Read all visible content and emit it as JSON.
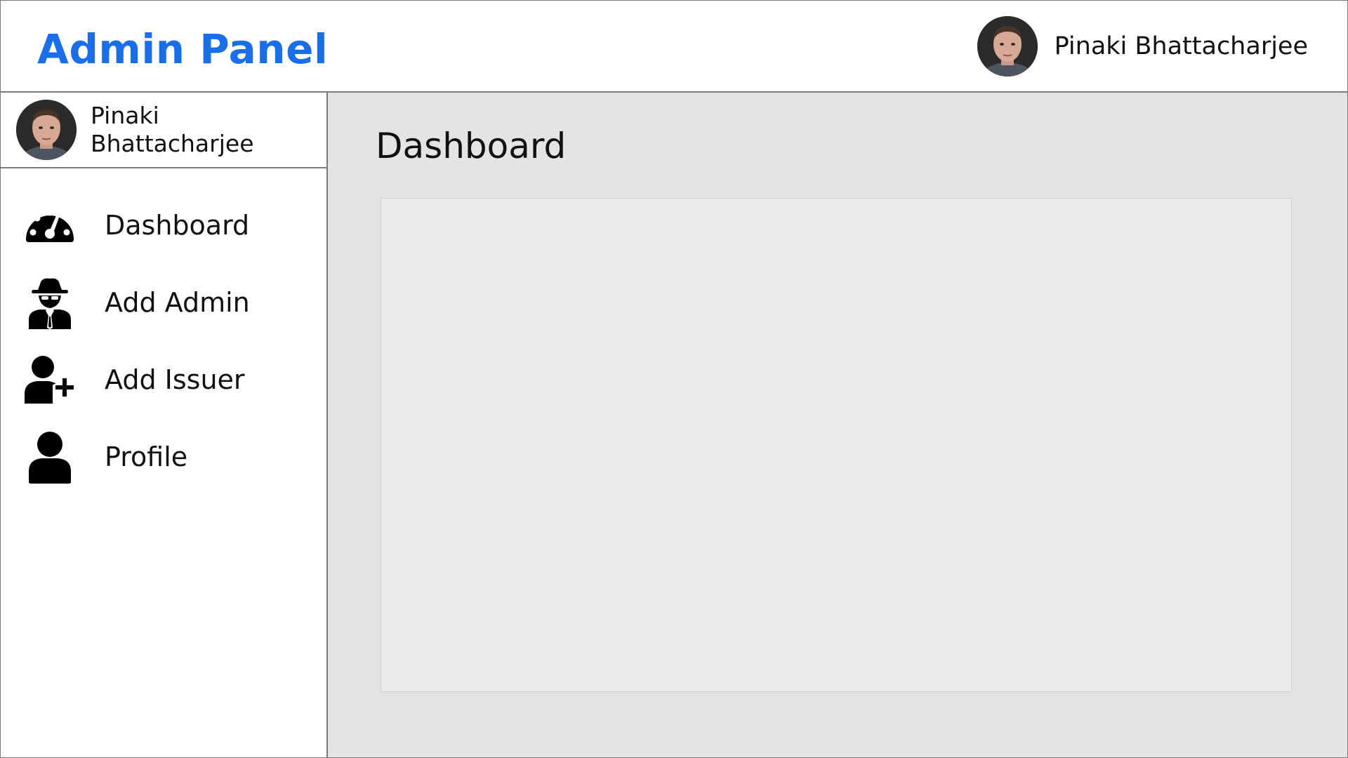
{
  "app": {
    "title": "Admin Panel",
    "accent_color": "#1a6ee8"
  },
  "header": {
    "user_name": "Pinaki Bhattacharjee",
    "avatar_icon": "user-avatar-photo"
  },
  "sidebar": {
    "user_name": "Pinaki Bhattacharjee",
    "avatar_icon": "user-avatar-photo",
    "items": [
      {
        "label": "Dashboard",
        "icon": "dashboard-gauge-icon"
      },
      {
        "label": "Add Admin",
        "icon": "spy-agent-icon"
      },
      {
        "label": "Add Issuer",
        "icon": "user-plus-icon"
      },
      {
        "label": "Profile",
        "icon": "user-icon"
      }
    ]
  },
  "main": {
    "title": "Dashboard"
  }
}
